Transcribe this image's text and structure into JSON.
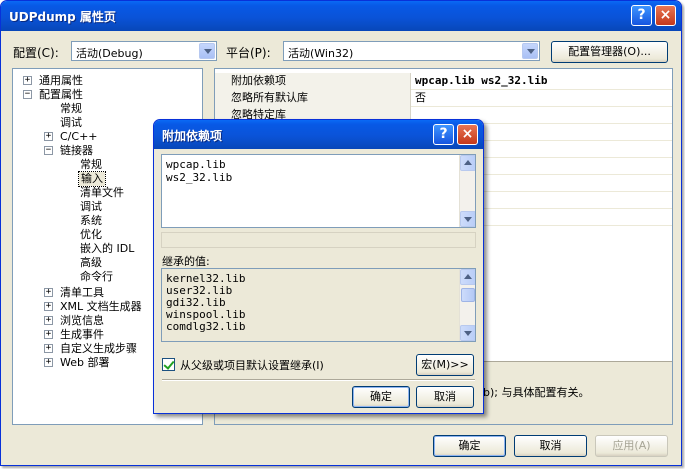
{
  "window": {
    "title": "UDPdump 属性页",
    "help_glyph": "?",
    "close_glyph": "×"
  },
  "toolbar": {
    "config_label": "配置(C):",
    "config_value": "活动(Debug)",
    "platform_label": "平台(P):",
    "platform_value": "活动(Win32)",
    "config_manager_label": "配置管理器(O)..."
  },
  "tree": {
    "items": [
      {
        "label": "通用属性",
        "expander": "+"
      },
      {
        "label": "配置属性",
        "expander": "−"
      },
      {
        "label": "常规"
      },
      {
        "label": "调试"
      },
      {
        "label": "C/C++",
        "expander": "+"
      },
      {
        "label": "链接器",
        "expander": "−"
      },
      {
        "label": "常规"
      },
      {
        "label": "输入",
        "selected": true
      },
      {
        "label": "清单文件"
      },
      {
        "label": "调试"
      },
      {
        "label": "系统"
      },
      {
        "label": "优化"
      },
      {
        "label": "嵌入的 IDL"
      },
      {
        "label": "高级"
      },
      {
        "label": "命令行"
      },
      {
        "label": "清单工具",
        "expander": "+"
      },
      {
        "label": "XML 文档生成器",
        "expander": "+"
      },
      {
        "label": "浏览信息",
        "expander": "+"
      },
      {
        "label": "生成事件",
        "expander": "+"
      },
      {
        "label": "自定义生成步骤",
        "expander": "+"
      },
      {
        "label": "Web 部署",
        "expander": "+"
      }
    ]
  },
  "grid": {
    "rows": [
      {
        "key": "附加依赖项",
        "value": "wpcap.lib ws2_32.lib",
        "bold": true
      },
      {
        "key": "忽略所有默认库",
        "value": "否"
      },
      {
        "key": "忽略特定库",
        "value": ""
      }
    ],
    "description_fragment": "b); 与具体配置有关。"
  },
  "dialog": {
    "title": "附加依赖项",
    "help_glyph": "?",
    "close_glyph": "×",
    "edit_lines": [
      "wpcap.lib",
      "ws2_32.lib"
    ],
    "inherited_label": "继承的值:",
    "inherited_lines": [
      "kernel32.lib",
      "user32.lib",
      "gdi32.lib",
      "winspool.lib",
      "comdlg32.lib"
    ],
    "inherit_checkbox_label": "从父级或项目默认设置继承(I)",
    "inherit_checked": true,
    "macro_button_label": "宏(M)>>",
    "ok_label": "确定",
    "cancel_label": "取消"
  },
  "footer": {
    "ok_label": "确定",
    "cancel_label": "取消",
    "apply_label": "应用(A)"
  }
}
